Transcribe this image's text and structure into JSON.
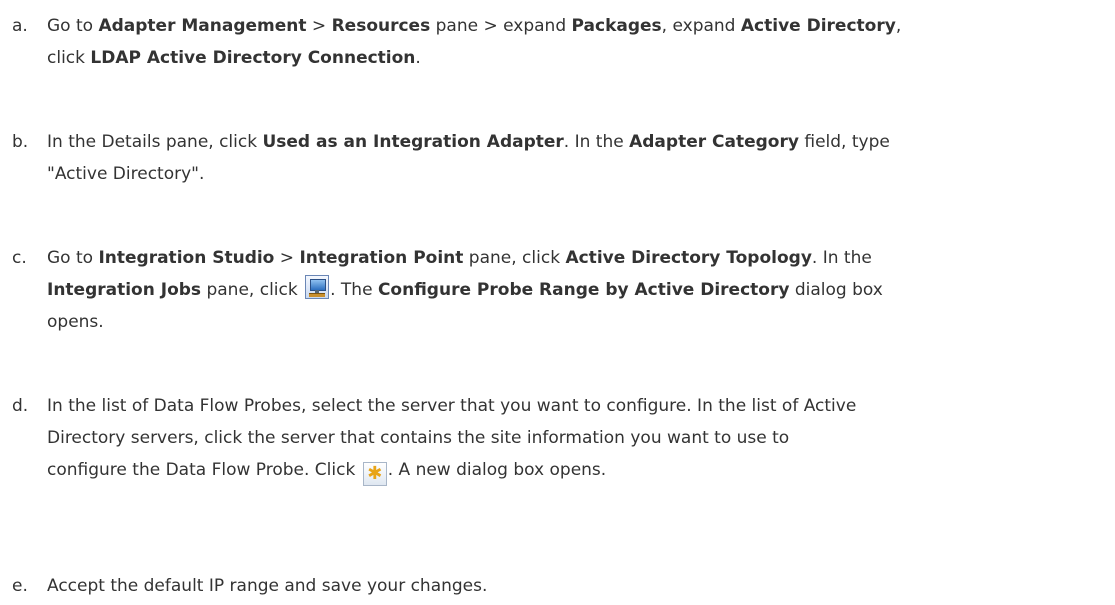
{
  "steps": [
    {
      "marker": "a.",
      "lines": [
        [
          {
            "t": "Go to ",
            "b": false
          },
          {
            "t": "Adapter Management",
            "b": true
          },
          {
            "t": " > ",
            "b": false
          },
          {
            "t": "Resources",
            "b": true
          },
          {
            "t": " pane > expand ",
            "b": false
          },
          {
            "t": "Packages",
            "b": true
          },
          {
            "t": ", expand ",
            "b": false
          },
          {
            "t": "Active Directory",
            "b": true
          },
          {
            "t": ",",
            "b": false
          }
        ],
        [
          {
            "t": "click ",
            "b": false
          },
          {
            "t": "LDAP Active Directory Connection",
            "b": true
          },
          {
            "t": ".",
            "b": false
          }
        ]
      ]
    },
    {
      "marker": "b.",
      "lines": [
        [
          {
            "t": "In the Details pane, click ",
            "b": false
          },
          {
            "t": "Used as an Integration Adapter",
            "b": true
          },
          {
            "t": ". In the ",
            "b": false
          },
          {
            "t": "Adapter Category",
            "b": true
          },
          {
            "t": " field, type",
            "b": false
          }
        ],
        [
          {
            "t": "\"Active Directory\".",
            "b": false
          }
        ]
      ]
    },
    {
      "marker": "c.",
      "lines": [
        [
          {
            "t": "Go to ",
            "b": false
          },
          {
            "t": "Integration Studio",
            "b": true
          },
          {
            "t": " > ",
            "b": false
          },
          {
            "t": "Integration Point",
            "b": true
          },
          {
            "t": " pane, click ",
            "b": false
          },
          {
            "t": "Active Directory Topology",
            "b": true
          },
          {
            "t": ". In the",
            "b": false
          }
        ],
        [
          {
            "t": "Integration Jobs",
            "b": true
          },
          {
            "t": " pane, click ",
            "b": false
          },
          {
            "icon": "configure-probe-range-icon"
          },
          {
            "t": ". The ",
            "b": false
          },
          {
            "t": "Configure Probe Range by Active Directory",
            "b": true
          },
          {
            "t": " dialog box",
            "b": false
          }
        ],
        [
          {
            "t": "opens.",
            "b": false
          }
        ]
      ]
    },
    {
      "marker": "d.",
      "lines": [
        [
          {
            "t": "In the list of Data Flow Probes, select the server that you want to configure. In the list of Active",
            "b": false
          }
        ],
        [
          {
            "t": "Directory servers, click the server that contains the site information you want to use to",
            "b": false
          }
        ],
        [
          {
            "t": "configure the Data Flow Probe. Click ",
            "b": false
          },
          {
            "icon": "new-icon"
          },
          {
            "t": ". A new dialog box opens.",
            "b": false
          }
        ]
      ]
    },
    {
      "marker": "e.",
      "lines": [
        [
          {
            "t": "Accept the default IP range and save your changes.",
            "b": false
          }
        ]
      ]
    }
  ]
}
